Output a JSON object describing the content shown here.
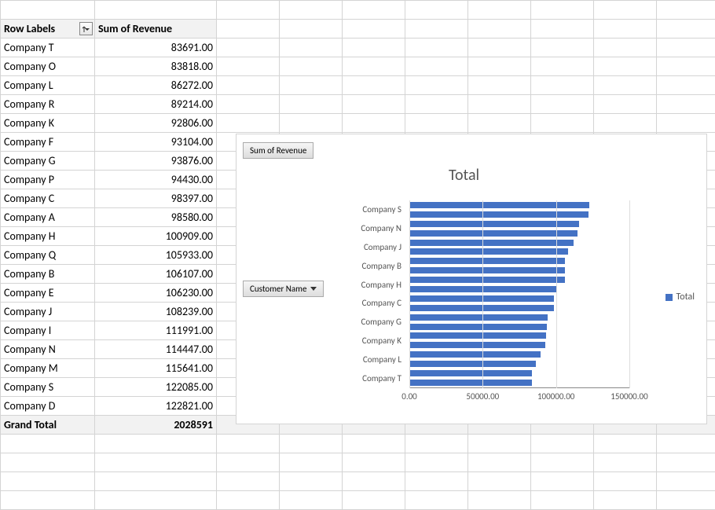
{
  "pivot": {
    "headers": {
      "row_labels": "Row Labels",
      "sum_revenue": "Sum of Revenue"
    },
    "rows": [
      {
        "label": "Company T",
        "value": "83691.00"
      },
      {
        "label": "Company O",
        "value": "83818.00"
      },
      {
        "label": "Company L",
        "value": "86272.00"
      },
      {
        "label": "Company R",
        "value": "89214.00"
      },
      {
        "label": "Company K",
        "value": "92806.00"
      },
      {
        "label": "Company F",
        "value": "93104.00"
      },
      {
        "label": "Company G",
        "value": "93876.00"
      },
      {
        "label": "Company P",
        "value": "94430.00"
      },
      {
        "label": "Company C",
        "value": "98397.00"
      },
      {
        "label": "Company A",
        "value": "98580.00"
      },
      {
        "label": "Company H",
        "value": "100909.00"
      },
      {
        "label": "Company Q",
        "value": "105933.00"
      },
      {
        "label": "Company B",
        "value": "106107.00"
      },
      {
        "label": "Company E",
        "value": "106230.00"
      },
      {
        "label": "Company J",
        "value": "108239.00"
      },
      {
        "label": "Company I",
        "value": "111991.00"
      },
      {
        "label": "Company N",
        "value": "114447.00"
      },
      {
        "label": "Company M",
        "value": "115641.00"
      },
      {
        "label": "Company S",
        "value": "122085.00"
      },
      {
        "label": "Company D",
        "value": "122821.00"
      }
    ],
    "grand_total": {
      "label": "Grand Total",
      "value": "2028591"
    }
  },
  "chart": {
    "buttons": {
      "sum_revenue": "Sum of Revenue",
      "customer_name": "Customer Name"
    },
    "title": "Total",
    "legend": "Total",
    "x_ticks": [
      {
        "label": "0.00",
        "value": 0
      },
      {
        "label": "50000.00",
        "value": 50000
      },
      {
        "label": "100000.00",
        "value": 100000
      },
      {
        "label": "150000.00",
        "value": 150000
      }
    ]
  },
  "chart_data": {
    "type": "bar",
    "orientation": "horizontal",
    "title": "Total",
    "xlabel": "",
    "ylabel": "",
    "xlim": [
      0,
      150000
    ],
    "categories_top_to_bottom": [
      "Company D",
      "Company S",
      "Company M",
      "Company N",
      "Company I",
      "Company J",
      "Company E",
      "Company B",
      "Company Q",
      "Company H",
      "Company A",
      "Company C",
      "Company P",
      "Company G",
      "Company F",
      "Company K",
      "Company R",
      "Company L",
      "Company O",
      "Company T"
    ],
    "y_tick_labels_shown": [
      "Company S",
      "Company N",
      "Company J",
      "Company B",
      "Company H",
      "Company C",
      "Company G",
      "Company K",
      "Company L",
      "Company T"
    ],
    "series": [
      {
        "name": "Total",
        "color": "#4472C4",
        "values_top_to_bottom": [
          122821,
          122085,
          115641,
          114447,
          111991,
          108239,
          106230,
          106107,
          105933,
          100909,
          98580,
          98397,
          94430,
          93876,
          93104,
          92806,
          89214,
          86272,
          83818,
          83691
        ]
      }
    ]
  }
}
